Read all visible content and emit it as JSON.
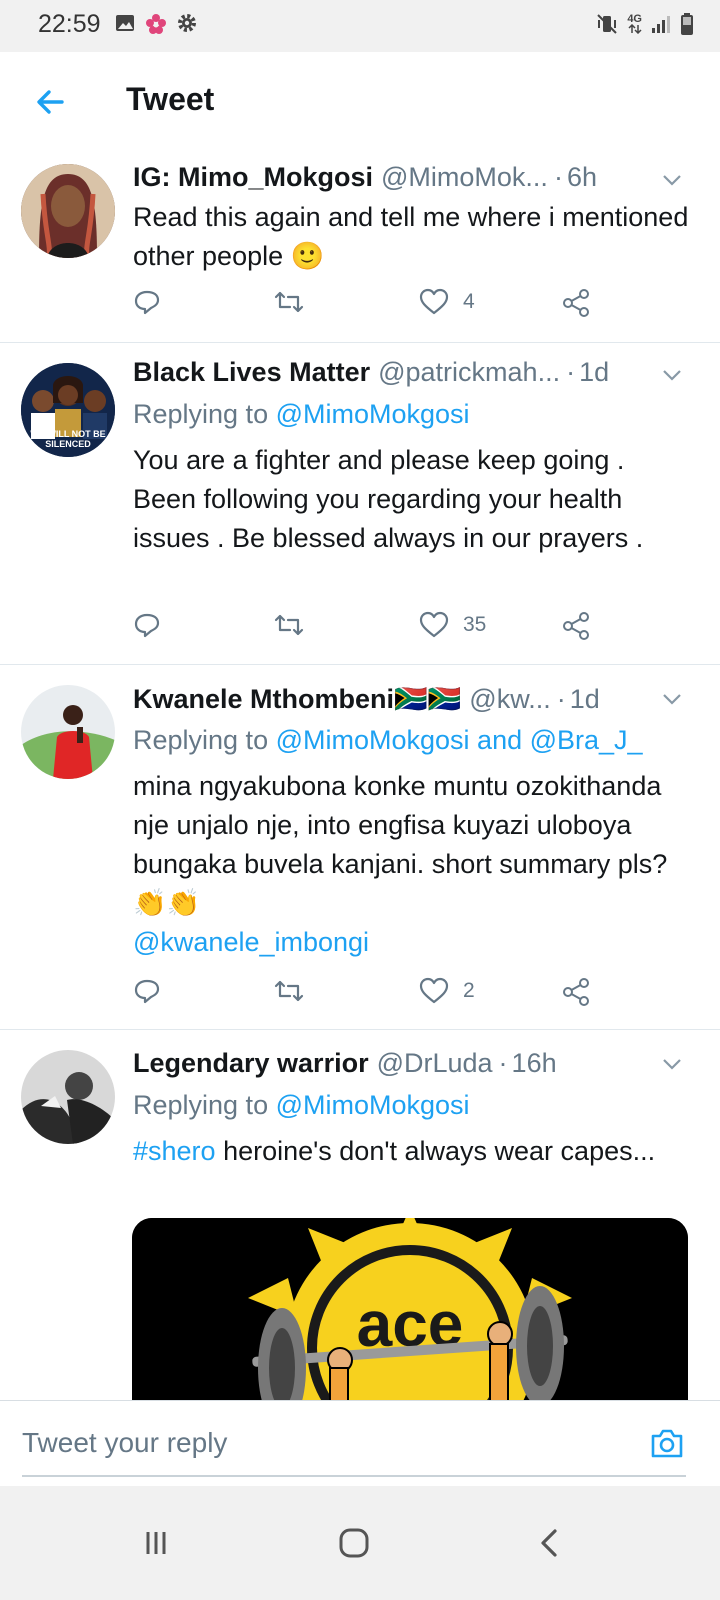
{
  "status_bar": {
    "time": "22:59",
    "left_icons": [
      "image-icon",
      "flower-icon",
      "settings-icon"
    ],
    "right_icons": [
      "mute-vibrate-icon",
      "network-4g-icon",
      "signal-icon",
      "battery-icon"
    ],
    "network_label": "4G"
  },
  "app_bar": {
    "title": "Tweet",
    "back_icon": "arrow-left-icon"
  },
  "colors": {
    "accent": "#1da1f2",
    "text_primary": "#14171a",
    "text_secondary": "#657786",
    "divider": "#e1e8ed"
  },
  "tweets": [
    {
      "name": "IG: Mimo_Mokgosi",
      "handle": "@MimoMok...",
      "time": "6h",
      "replying_prefix": "",
      "replying_to": "",
      "body": "Read this again and tell me where i mentioned other people",
      "body_emoji": "🙂",
      "likes": "4"
    },
    {
      "name": "Black Lives Matter",
      "handle": "@patrickmah...",
      "time": "1d",
      "replying_prefix": "Replying to",
      "replying_to": "@MimoMokgosi",
      "avatar_caption": "WE WILL NOT BE SILENCED",
      "body": "You are a fighter and please keep going . Been following you regarding your health issues . Be blessed always in our prayers .",
      "likes": "35"
    },
    {
      "name": "Kwanele Mthombeni",
      "name_emoji": "🇿🇦🇿🇦",
      "handle": "@kw...",
      "time": "1d",
      "replying_prefix": "Replying to",
      "replying_to": "@MimoMokgosi and @Bra_J_",
      "body": "mina ngyakubona konke muntu ozokithanda nje unjalo nje, into engfisa kuyazi uloboya bungaka buvela kanjani. short summary pls?",
      "body_emoji": "👏👏",
      "body_mention": "@kwanele_imbongi",
      "likes": "2"
    },
    {
      "name": "Legendary warrior",
      "handle": "@DrLuda",
      "time": "16h",
      "replying_prefix": "Replying to",
      "replying_to": "@MimoMokgosi",
      "body_hashtag": "#shero",
      "body": " heroine's don't always wear capes...",
      "media_text": "ace"
    }
  ],
  "composer": {
    "placeholder": "Tweet your reply",
    "camera_icon": "camera-icon"
  },
  "nav_bar": {
    "buttons": [
      "recent-apps-icon",
      "home-icon",
      "back-icon"
    ]
  }
}
